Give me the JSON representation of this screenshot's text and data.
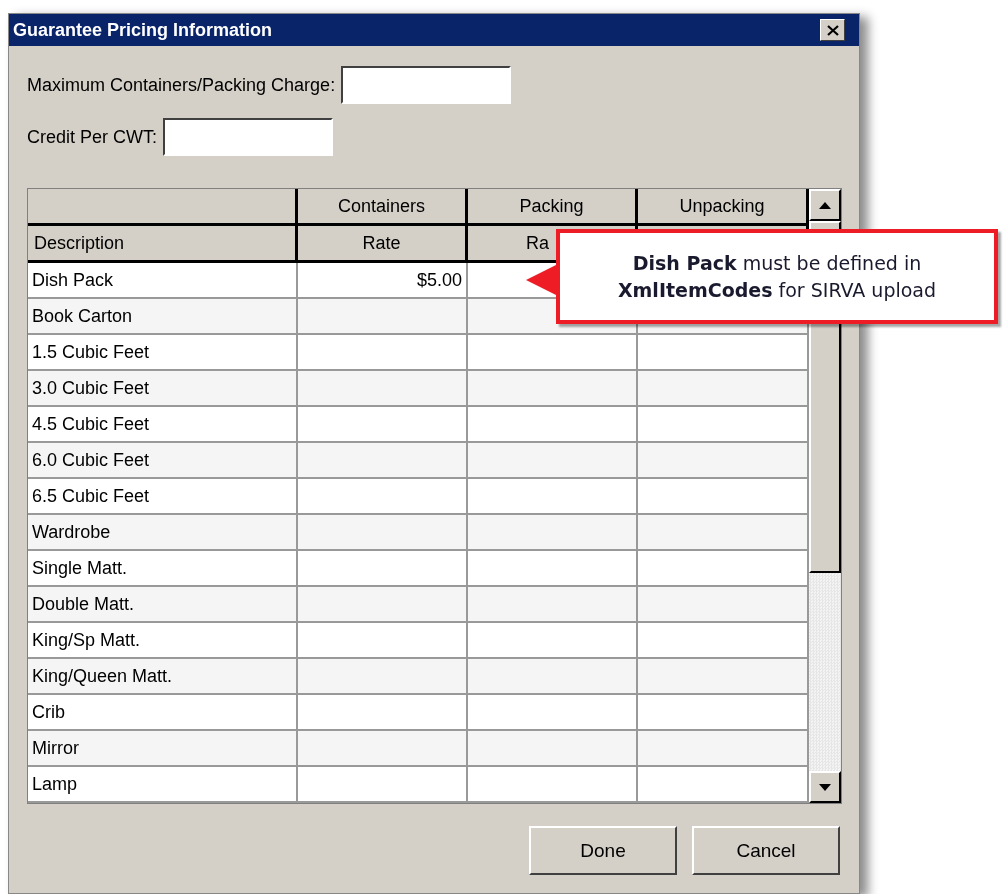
{
  "window": {
    "title": "Guarantee Pricing Information"
  },
  "fields": [
    {
      "label": "Maximum Containers/Packing Charge:"
    },
    {
      "label": "Credit Per CWT:"
    }
  ],
  "table": {
    "columns": [
      {
        "sub": "Description"
      },
      {
        "title": "Containers",
        "sub": "Rate"
      },
      {
        "title": "Packing",
        "sub": "Ra",
        "cut": true
      },
      {
        "title": "Unpacking"
      }
    ],
    "rows": [
      {
        "description": "Dish Pack",
        "containers_rate": "$5.00"
      },
      {
        "description": "Book Carton"
      },
      {
        "description": "1.5 Cubic Feet"
      },
      {
        "description": "3.0 Cubic Feet"
      },
      {
        "description": "4.5 Cubic Feet"
      },
      {
        "description": "6.0 Cubic Feet"
      },
      {
        "description": "6.5 Cubic Feet"
      },
      {
        "description": "Wardrobe"
      },
      {
        "description": "Single Matt."
      },
      {
        "description": "Double Matt."
      },
      {
        "description": "King/Sp Matt."
      },
      {
        "description": "King/Queen Matt."
      },
      {
        "description": "Crib"
      },
      {
        "description": "Mirror"
      },
      {
        "description": "Lamp"
      }
    ]
  },
  "buttons": [
    "Done",
    "Cancel"
  ],
  "callout": {
    "text": "**Dish Pack** must be defined in **XmlItemCodes** for SIRVA upload"
  }
}
